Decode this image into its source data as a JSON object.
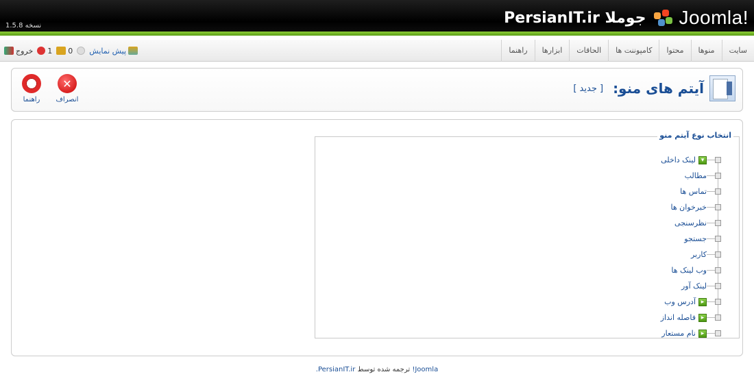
{
  "header": {
    "version": "نسخه 1.5.8",
    "brand": "PersianIT.ir جوملا",
    "logo_text": "Joomla!"
  },
  "mainmenu": [
    {
      "label": "سایت"
    },
    {
      "label": "منوها"
    },
    {
      "label": "محتوا"
    },
    {
      "label": "کامپوننت ها"
    },
    {
      "label": "الحاقات"
    },
    {
      "label": "ابزارها"
    },
    {
      "label": "راهنما"
    }
  ],
  "status": {
    "preview": "پیش نمایش",
    "messages_count": "0",
    "users_count": "1",
    "logout": "خروج"
  },
  "toolbar": {
    "title": "آیتم های منو:",
    "subtitle": "[ جدید ]",
    "cancel_label": "انصراف",
    "help_label": "راهنما"
  },
  "tree": {
    "legend": "انتخاب نوع آیتم منو",
    "items": [
      {
        "label": "لینک داخلی",
        "toggle": "▾"
      },
      {
        "label": "مطالب",
        "toggle": ""
      },
      {
        "label": "تماس ها",
        "toggle": ""
      },
      {
        "label": "خبرخوان ها",
        "toggle": ""
      },
      {
        "label": "نظرسنجی",
        "toggle": ""
      },
      {
        "label": "جستجو",
        "toggle": ""
      },
      {
        "label": "کاربر",
        "toggle": ""
      },
      {
        "label": "وب لینک ها",
        "toggle": ""
      },
      {
        "label": "لینک آور",
        "toggle": ""
      },
      {
        "label": "آدرس وب",
        "toggle": "▸"
      },
      {
        "label": "فاصله انداز",
        "toggle": "▸"
      },
      {
        "label": "نام مستعار",
        "toggle": "▸"
      }
    ]
  },
  "footer": {
    "text_joomla": "Joomla!",
    "text_middle": " ترجمه شده توسط ",
    "text_site": "PersianIT.ir."
  },
  "colors": {
    "accent_blue": "#1a4e95",
    "header_green": "#6fb32a",
    "cancel_red": "#c80000"
  }
}
